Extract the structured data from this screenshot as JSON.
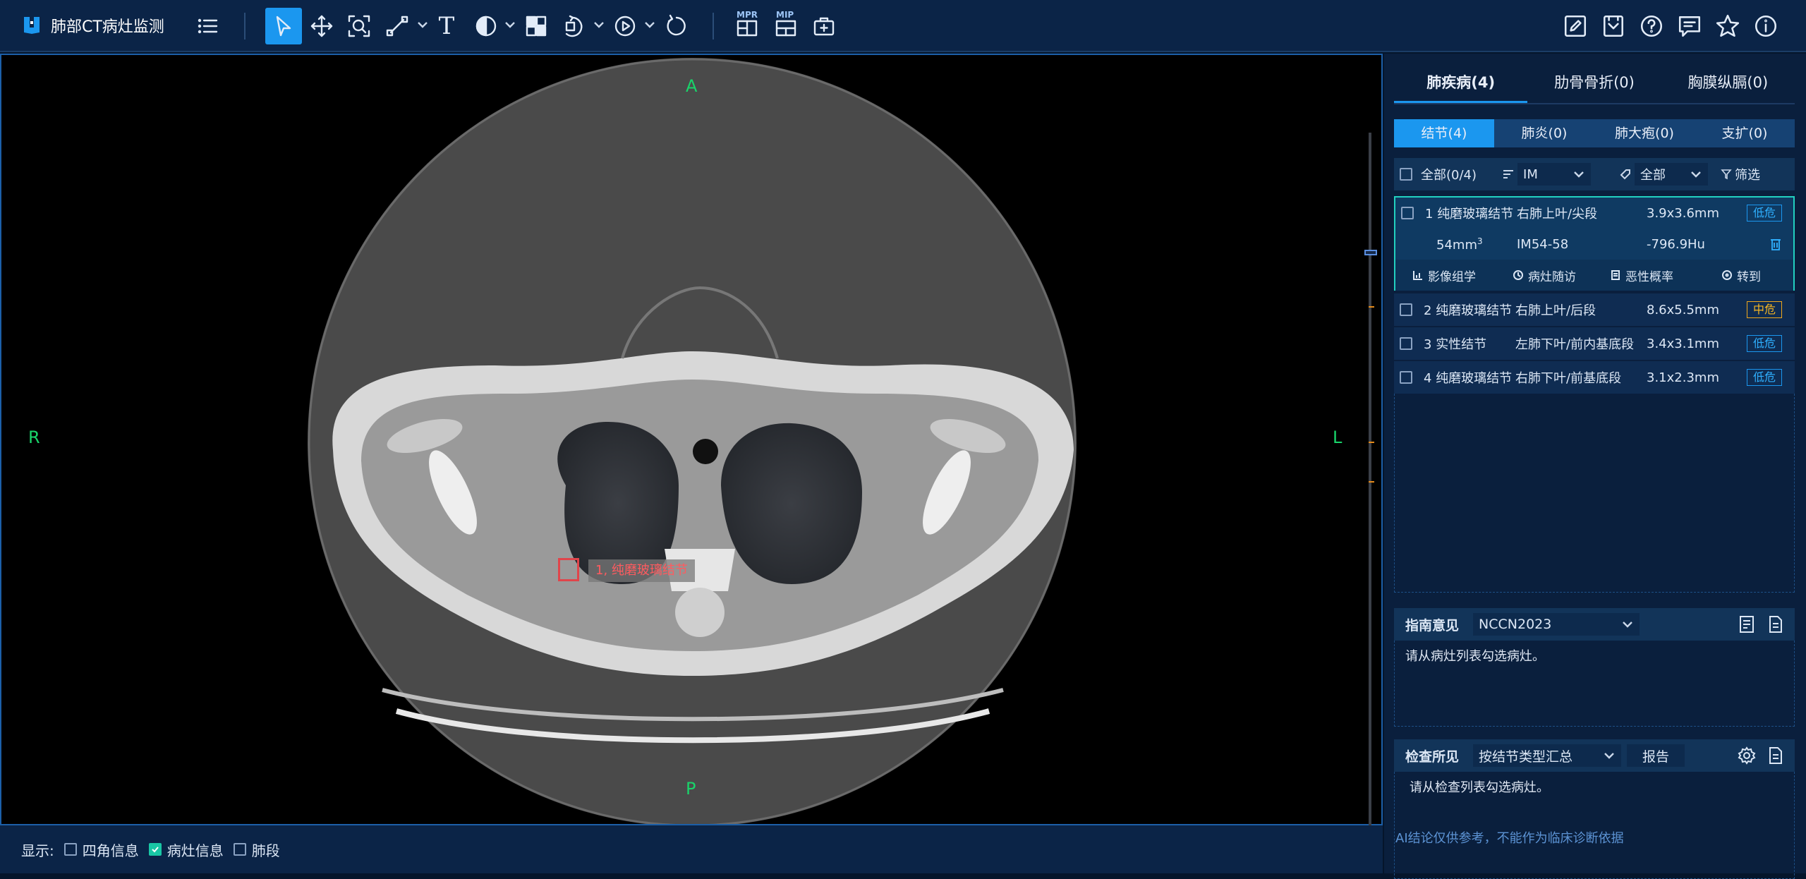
{
  "app": {
    "title": "肺部CT病灶监测"
  },
  "toolbar": {
    "left_icons": [
      "logo-icon",
      "menu-icon",
      "pointer-icon",
      "move-icon",
      "zoom-icon",
      "measure-icon",
      "text-icon",
      "window-level-icon",
      "invert-icon",
      "rotate-icon",
      "play-icon",
      "reset-icon",
      "mpr-icon",
      "mip-icon",
      "case-icon"
    ],
    "mpr_label": "MPR",
    "mip_label": "MIP",
    "text_tool": "T",
    "right_icons": [
      "edit-icon",
      "save-icon",
      "help-icon",
      "feedback-icon",
      "star-icon",
      "info-icon"
    ]
  },
  "viewer": {
    "orient_top": "A",
    "orient_bottom": "P",
    "orient_left": "R",
    "orient_right": "L",
    "lesion_label": "1, 纯磨玻璃结节"
  },
  "status": {
    "display_label": "显示:",
    "options": [
      {
        "label": "四角信息",
        "checked": false
      },
      {
        "label": "病灶信息",
        "checked": true
      },
      {
        "label": "肺段",
        "checked": false
      }
    ]
  },
  "side": {
    "disease_tabs": [
      "肺疾病(4)",
      "肋骨骨折(0)",
      "胸膜纵膈(0)"
    ],
    "active_disease_tab": 0,
    "sub_tabs": [
      "结节(4)",
      "肺炎(0)",
      "肺大疱(0)",
      "支扩(0)"
    ],
    "active_sub_tab": 0,
    "filter": {
      "all_label": "全部(0/4)",
      "sort_value": "IM",
      "type_value": "全部",
      "filter_label": "筛选"
    },
    "nodules": [
      {
        "id": "1",
        "type": "纯磨玻璃结节",
        "location": "右肺上叶/尖段",
        "size": "3.9x3.6mm",
        "risk": "低危",
        "risk_level": "low",
        "volume": "54mm",
        "volume_sup": "3",
        "im": "IM54-58",
        "density": "-796.9Hu"
      },
      {
        "id": "2",
        "type": "纯磨玻璃结节",
        "location": "右肺上叶/后段",
        "size": "8.6x5.5mm",
        "risk": "中危",
        "risk_level": "mid"
      },
      {
        "id": "3",
        "type": "实性结节",
        "location": "左肺下叶/前内基底段",
        "size": "3.4x3.1mm",
        "risk": "低危",
        "risk_level": "low"
      },
      {
        "id": "4",
        "type": "纯磨玻璃结节",
        "location": "右肺下叶/前基底段",
        "size": "3.1x2.3mm",
        "risk": "低危",
        "risk_level": "low"
      }
    ],
    "nodule_actions": [
      "影像组学",
      "病灶随访",
      "恶性概率",
      "转到"
    ],
    "guideline": {
      "title": "指南意见",
      "value": "NCCN2023",
      "placeholder_text": "请从病灶列表勾选病灶。"
    },
    "findings": {
      "title": "检查所见",
      "value": "按结节类型汇总",
      "report_label": "报告",
      "placeholder_text": "请从检查列表勾选病灶。"
    },
    "disclaimer": "AI结论仅供参考，不能作为临床诊断依据"
  },
  "colors": {
    "accent": "#1b97ef",
    "bg": "#05152b",
    "panel": "#0b2447",
    "orient": "#19d46a",
    "lesion": "#e0454b",
    "selected_border": "#22d0c0"
  }
}
